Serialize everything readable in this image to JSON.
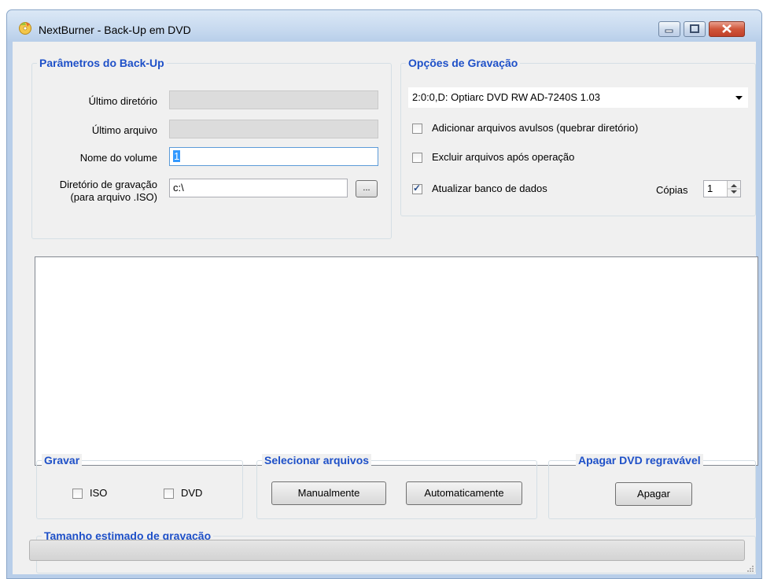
{
  "window": {
    "title": "NextBurner - Back-Up em DVD"
  },
  "backup_params": {
    "title": "Parâmetros do Back-Up",
    "last_dir_label": "Último diretório",
    "last_file_label": "Último arquivo",
    "volume_name_label": "Nome do volume",
    "volume_name_value": "1",
    "write_dir_label_1": "Diretório de gravação",
    "write_dir_label_2": "(para arquivo .ISO)",
    "write_dir_value": "c:\\",
    "browse_label": "..."
  },
  "write_options": {
    "title": "Opções de Gravação",
    "drive_selected": "2:0:0,D: Optiarc  DVD RW AD-7240S  1.03",
    "add_loose_label": "Adicionar arquivos avulsos (quebrar diretório)",
    "add_loose_checked": false,
    "delete_after_label": "Excluir arquivos após operação",
    "delete_after_checked": false,
    "update_db_label": "Atualizar banco de dados",
    "update_db_checked": true,
    "copies_label": "Cópias",
    "copies_value": "1"
  },
  "record": {
    "title": "Gravar",
    "iso_label": "ISO",
    "iso_checked": false,
    "dvd_label": "DVD",
    "dvd_checked": false
  },
  "select_files": {
    "title": "Selecionar arquivos",
    "manual_label": "Manualmente",
    "auto_label": "Automaticamente"
  },
  "erase": {
    "title": "Apagar DVD regravável",
    "button_label": "Apagar"
  },
  "estimate": {
    "title": "Tamanho estimado de gravação",
    "progress": 0
  }
}
